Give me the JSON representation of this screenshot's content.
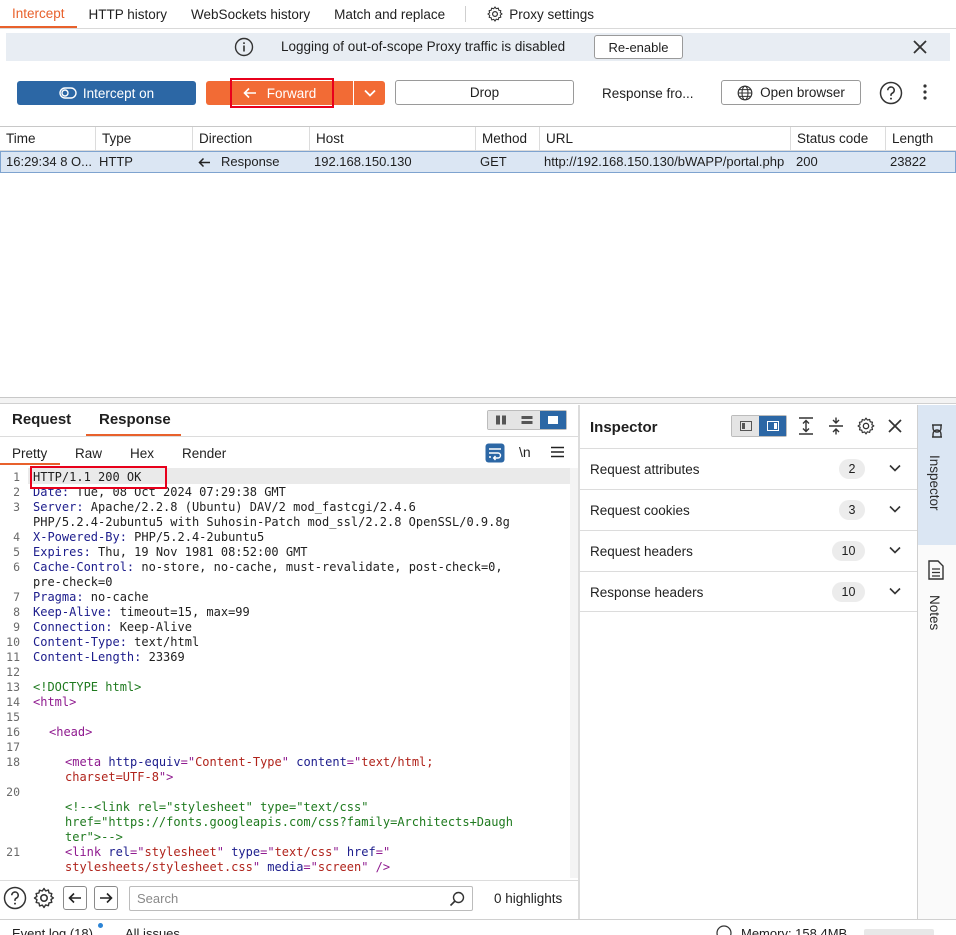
{
  "tabs": [
    {
      "label": "Intercept"
    },
    {
      "label": "HTTP history"
    },
    {
      "label": "WebSockets history"
    },
    {
      "label": "Match and replace"
    },
    {
      "label": "Proxy settings"
    }
  ],
  "banner": {
    "message": "Logging of out-of-scope Proxy traffic is disabled",
    "button": "Re-enable"
  },
  "toolbar": {
    "intercept": "Intercept on",
    "forward": "Forward",
    "drop": "Drop",
    "response_from": "Response fro...",
    "open_browser": "Open browser"
  },
  "table": {
    "headers": [
      "Time",
      "Type",
      "Direction",
      "Host",
      "Method",
      "URL",
      "Status code",
      "Length"
    ],
    "rows": [
      {
        "time": "16:29:34 8 O...",
        "type": "HTTP",
        "direction": "Response",
        "host": "192.168.150.130",
        "method": "GET",
        "url": "http://192.168.150.130/bWAPP/portal.php",
        "status": "200",
        "length": "23822"
      }
    ]
  },
  "editor": {
    "tabs": [
      "Request",
      "Response"
    ],
    "subtabs": [
      "Pretty",
      "Raw",
      "Hex",
      "Render"
    ],
    "newline_toggle": "\\n",
    "line_numbers": [
      "1",
      "2",
      "3",
      "",
      "4",
      "5",
      "6",
      "",
      "7",
      "8",
      "9",
      "10",
      "11",
      "12",
      "13",
      "14",
      "15",
      "16",
      "17",
      "18",
      "",
      "19",
      "20",
      "",
      "",
      "21",
      ""
    ],
    "search_placeholder": "Search",
    "highlights": "0 highlights"
  },
  "code": {
    "l1": "HTTP/1.1 200 OK",
    "l2k": "Date:",
    "l2v": " Tue, 08 Oct 2024 07:29:38 GMT",
    "l3k": "Server:",
    "l3v": " Apache/2.2.8 (Ubuntu) DAV/2 mod_fastcgi/2.4.6",
    "l3c": "PHP/5.2.4-2ubuntu5 with Suhosin-Patch mod_ssl/2.2.8 OpenSSL/0.9.8g",
    "l4k": "X-Powered-By:",
    "l4v": " PHP/5.2.4-2ubuntu5",
    "l5k": "Expires:",
    "l5v": " Thu, 19 Nov 1981 08:52:00 GMT",
    "l6k": "Cache-Control:",
    "l6v": " no-store, no-cache, must-revalidate, post-check=0,",
    "l6c": "pre-check=0",
    "l7k": "Pragma:",
    "l7v": " no-cache",
    "l8k": "Keep-Alive:",
    "l8v": " timeout=15, max=99",
    "l9k": "Connection:",
    "l9v": " Keep-Alive",
    "l10k": "Content-Type:",
    "l10v": " text/html",
    "l11k": "Content-Length:",
    "l11v": " 23369",
    "l13": "<!DOCTYPE html>",
    "l14": "<html>",
    "l16": "<head>",
    "l18a": "<meta ",
    "l18b": "http-equiv",
    "l18c": "=\"",
    "l18d": "Content-Type",
    "l18e": "\" ",
    "l18f": "content",
    "l18g": "=\"",
    "l18h": "text/html;",
    "l18i": "charset=UTF-8",
    "l18j": "\">",
    "l20a": "<!--<link rel=\"stylesheet\" type=\"text/css\"",
    "l20b": "href=\"https://fonts.googleapis.com/css?family=Architects+Daugh",
    "l20c": "ter\">-->",
    "l21a": "<link ",
    "l21b": "rel",
    "l21c": "=\"",
    "l21d": "stylesheet",
    "l21e": "\" ",
    "l21f": "type",
    "l21g": "=\"",
    "l21h": "text/css",
    "l21i": "\" ",
    "l21j": "href",
    "l21k": "=\"",
    "l21l": "stylesheets/stylesheet.css",
    "l21m": "\" ",
    "l21n": "media",
    "l21o": "=\"",
    "l21p": "screen",
    "l21q": "\" />"
  },
  "inspector": {
    "title": "Inspector",
    "rows": [
      {
        "label": "Request attributes",
        "count": "2"
      },
      {
        "label": "Request cookies",
        "count": "3"
      },
      {
        "label": "Request headers",
        "count": "10"
      },
      {
        "label": "Response headers",
        "count": "10"
      }
    ]
  },
  "rail": {
    "inspector": "Inspector",
    "notes": "Notes"
  },
  "statusbar": {
    "event_log": "Event log (18)",
    "all_issues": "All issues",
    "memory": "Memory: 158.4MB"
  },
  "colors": {
    "accent": "#e8612c",
    "primary": "#2c67a5",
    "forward": "#f26b35",
    "highlight_box": "#e8001c"
  }
}
